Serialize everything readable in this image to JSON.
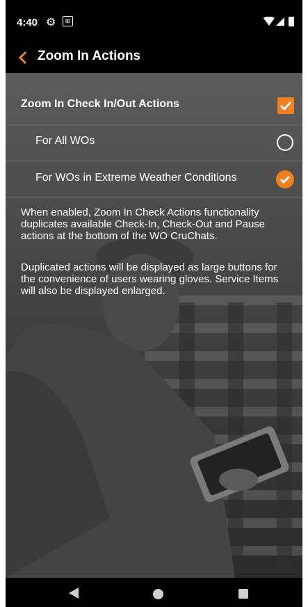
{
  "status_bar": {
    "time": "4:40"
  },
  "app_bar": {
    "title": "Zoom In Actions",
    "back_icon": "chevron-left-icon"
  },
  "settings": {
    "main_option": {
      "label": "Zoom In Check In/Out Actions",
      "checked": true
    },
    "sub_options": [
      {
        "label": "For All WOs",
        "selected": false
      },
      {
        "label": "For WOs in Extreme Weather Conditions",
        "selected": true
      }
    ]
  },
  "description": {
    "paragraph1": "When enabled, Zoom In Check Actions functionality duplicates available Check-In, Check-Out and Pause actions at the bottom of the WO CruChats.",
    "paragraph2": "Duplicated actions will be displayed as large buttons for the convenience of users wearing gloves. Service Items will also be displayed enlarged."
  },
  "colors": {
    "accent": "#f07f1e",
    "bar_background": "#000000",
    "text": "#ffffff"
  }
}
